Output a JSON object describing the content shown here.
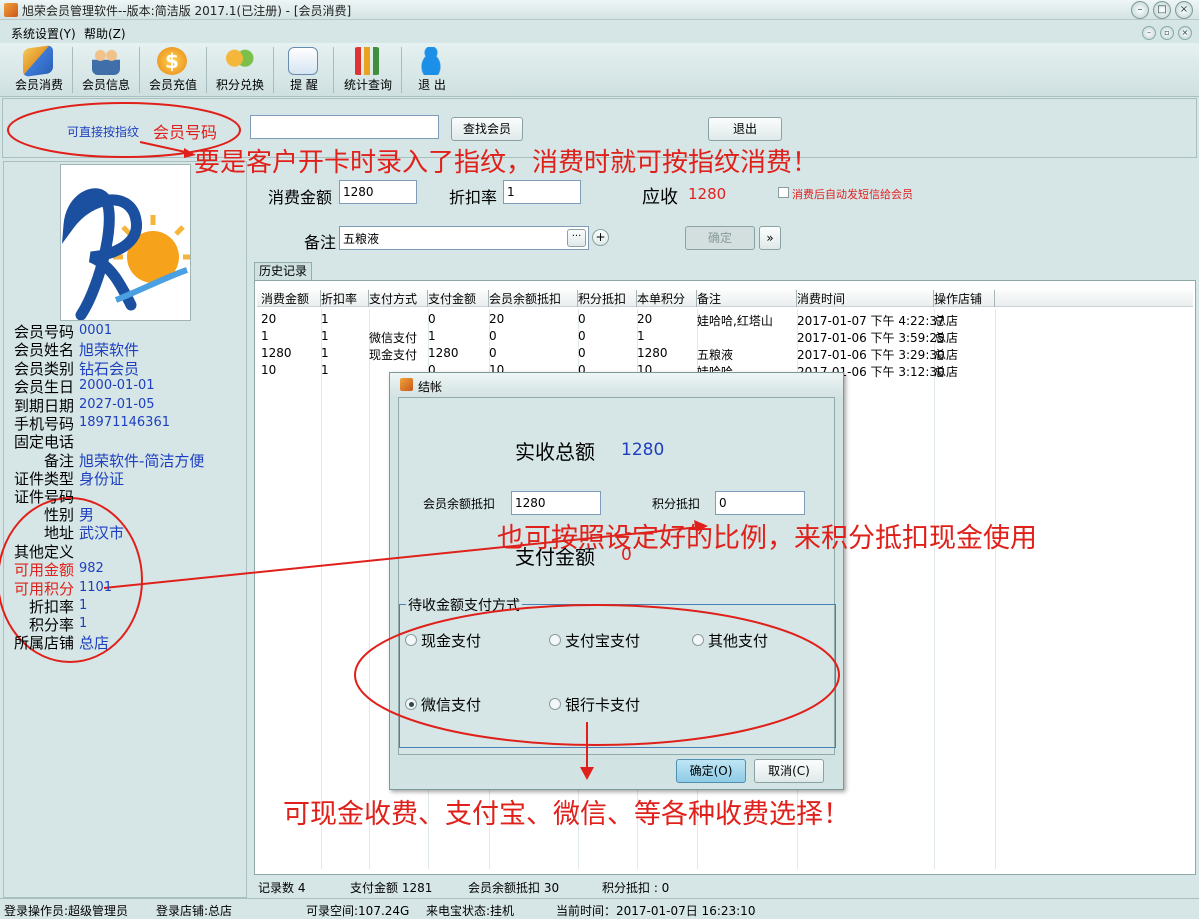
{
  "window": {
    "title": "旭荣会员管理软件--版本:简洁版 2017.1(已注册) - [会员消费]"
  },
  "menu": {
    "items": [
      "系统设置(Y)",
      "帮助(Z)"
    ]
  },
  "toolbar": {
    "items": [
      {
        "label": "会员消费",
        "icon": "card-pay-icon"
      },
      {
        "label": "会员信息",
        "icon": "users-icon"
      },
      {
        "label": "会员充值",
        "icon": "dollar-coin-icon"
      },
      {
        "label": "积分兑换",
        "icon": "gift-icon"
      },
      {
        "label": "提  醒",
        "icon": "reminder-icon"
      },
      {
        "label": "统计查询",
        "icon": "chart-icon"
      },
      {
        "label": "退  出",
        "icon": "exit-person-icon"
      }
    ]
  },
  "search": {
    "fingerprint_hint": "可直接按指纹",
    "member_no_label": "会员号码",
    "member_no_value": "",
    "find_button": "查找会员",
    "exit_button": "退出"
  },
  "member": {
    "fields": [
      {
        "key": "会员号码",
        "value": "0001"
      },
      {
        "key": "会员姓名",
        "value": "旭荣软件"
      },
      {
        "key": "会员类别",
        "value": "钻石会员"
      },
      {
        "key": "会员生日",
        "value": "2000-01-01"
      },
      {
        "key": "到期日期",
        "value": "2027-01-05"
      },
      {
        "key": "手机号码",
        "value": "18971146361"
      },
      {
        "key": "固定电话",
        "value": ""
      },
      {
        "key": "备注",
        "value": "旭荣软件-简洁方便"
      },
      {
        "key": "证件类型",
        "value": "身份证"
      },
      {
        "key": "证件号码",
        "value": ""
      },
      {
        "key": "性别",
        "value": "男"
      },
      {
        "key": "地址",
        "value": "武汉市"
      },
      {
        "key": "其他定义",
        "value": ""
      },
      {
        "key": "可用金额",
        "value": "982"
      },
      {
        "key": "可用积分",
        "value": "1101"
      },
      {
        "key": "折扣率",
        "value": "1"
      },
      {
        "key": "积分率",
        "value": "1"
      },
      {
        "key": "所属店铺",
        "value": "总店"
      }
    ]
  },
  "consume": {
    "amount_label": "消费金额",
    "amount_value": "1280",
    "discount_label": "折扣率",
    "discount_value": "1",
    "receivable_label": "应收",
    "receivable_value": "1280",
    "sms_label": "消费后自动发短信给会员",
    "remark_label": "备注",
    "remark_value": "五粮液",
    "confirm_button": "确定",
    "more_button": "···",
    "plus_button": "+",
    "next_button": "»"
  },
  "history": {
    "tab": "历史记录",
    "columns": [
      "消费金额",
      "折扣率",
      "支付方式",
      "支付金额",
      "会员余额抵扣",
      "积分抵扣",
      "本单积分",
      "备注",
      "消费时间",
      "操作店铺"
    ],
    "rows": [
      [
        "20",
        "1",
        "",
        "0",
        "20",
        "0",
        "20",
        "娃哈哈,红塔山",
        "2017-01-07 下午 4:22:37",
        "总店"
      ],
      [
        "1",
        "1",
        "微信支付",
        "1",
        "0",
        "0",
        "1",
        "",
        "2017-01-06 下午 3:59:25",
        "总店"
      ],
      [
        "1280",
        "1",
        "现金支付",
        "1280",
        "0",
        "0",
        "1280",
        "五粮液",
        "2017-01-06 下午 3:29:30",
        "总店"
      ],
      [
        "10",
        "1",
        "",
        "0",
        "10",
        "0",
        "10",
        "娃哈哈",
        "2017-01-06 下午 3:12:30",
        "总店"
      ]
    ],
    "summary": {
      "count": "记录数 4",
      "paid": "支付金额 1281",
      "balance": "会员余额抵扣 30",
      "points": "积分抵扣 : 0"
    }
  },
  "dialog": {
    "title": "结帐",
    "total_label": "实收总额",
    "total_value": "1280",
    "balance_label": "会员余额抵扣",
    "balance_value": "1280",
    "points_label": "积分抵扣",
    "points_value": "0",
    "pay_label": "支付金额",
    "pay_value": "0",
    "group_label": "待收金额支付方式",
    "methods": [
      {
        "label": "现金支付",
        "selected": false
      },
      {
        "label": "支付宝支付",
        "selected": false
      },
      {
        "label": "其他支付",
        "selected": false
      },
      {
        "label": "微信支付",
        "selected": true
      },
      {
        "label": "银行卡支付",
        "selected": false
      }
    ],
    "ok_button": "确定(O)",
    "cancel_button": "取消(C)"
  },
  "annotations": {
    "fingerprint": "要是客户开卡时录入了指纹，消费时就可按指纹消费！",
    "points": "也可按照设定好的比例，来积分抵扣现金使用",
    "payments": "可现金收费、支付宝、微信、等各种收费选择！"
  },
  "statusbar": {
    "operator": "登录操作员:超级管理员",
    "store": "登录店铺:总店",
    "space": "可录空间:107.24G",
    "caller": "来电宝状态:挂机",
    "time": "当前时间：2017-01-07日 16:23:10"
  },
  "colors": {
    "annotation_red": "#e0201a",
    "value_blue": "#1d3fbf",
    "accent_red": "#e02020"
  }
}
